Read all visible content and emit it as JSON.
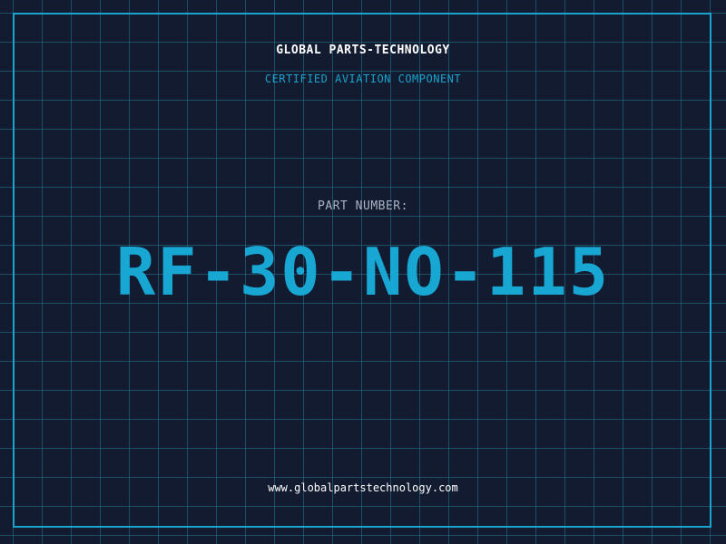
{
  "header": {
    "brand": "GLOBAL PARTS-TECHNOLOGY",
    "subtitle": "CERTIFIED AVIATION COMPONENT"
  },
  "main": {
    "part_label": "PART NUMBER:",
    "part_number": "RF-30-NO-115"
  },
  "footer": {
    "website": "www.globalpartstechnology.com"
  },
  "colors": {
    "background": "#121b30",
    "grid": "#2a7896",
    "frame": "#1aa3cc",
    "brand": "#ffffff",
    "subtitle": "#1aa3cc",
    "part_label": "#aab4c4",
    "part_number": "#18a6d2",
    "website": "#ffffff"
  }
}
